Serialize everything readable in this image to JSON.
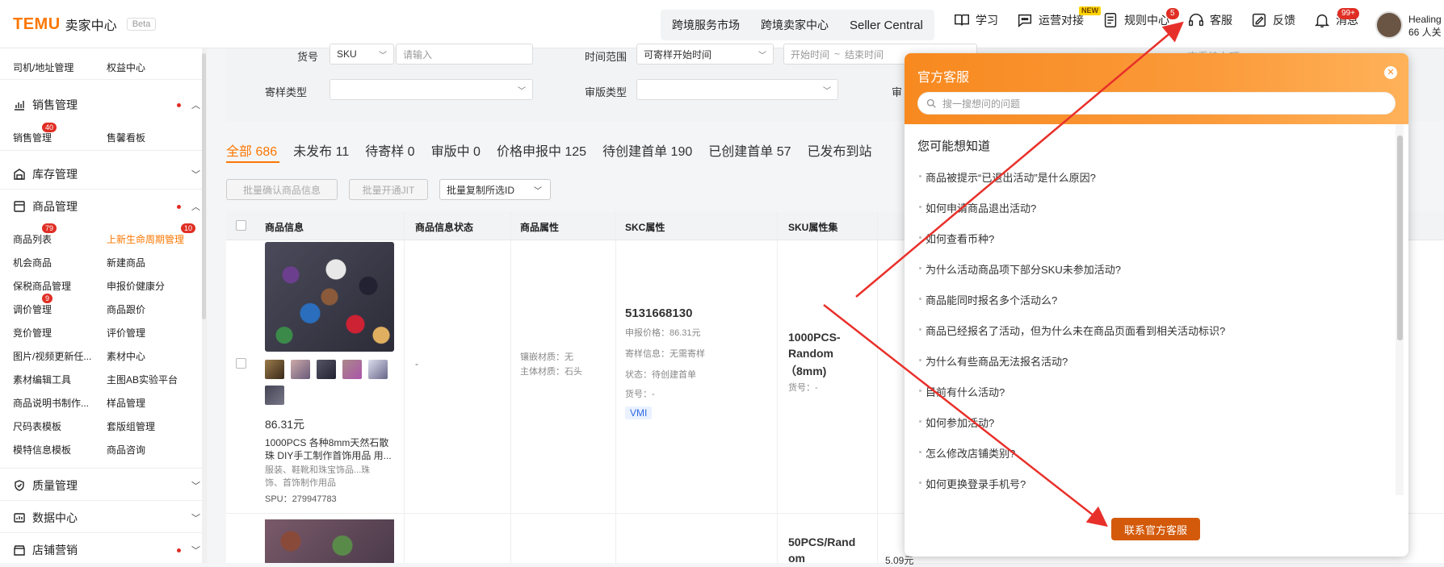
{
  "header": {
    "brand": "TEMU",
    "title": "卖家中心",
    "beta": "Beta",
    "nav": [
      "跨境服务市场",
      "跨境卖家中心",
      "Seller Central"
    ],
    "tools": [
      {
        "label": "学习",
        "icon": "book-icon",
        "badge": ""
      },
      {
        "label": "运营对接",
        "icon": "chat-icon",
        "badge": "NEW"
      },
      {
        "label": "规则中心",
        "icon": "rules-icon",
        "badge": "5"
      },
      {
        "label": "客服",
        "icon": "headset-icon",
        "badge": ""
      },
      {
        "label": "反馈",
        "icon": "feedback-icon",
        "badge": ""
      },
      {
        "label": "消息",
        "icon": "bell-icon",
        "badge": "99+"
      }
    ],
    "user_line1": "Healing",
    "user_line2": "66 人关"
  },
  "sidebar": {
    "top_items": [
      "司机/地址管理",
      "权益中心"
    ],
    "sections": [
      {
        "label": "销售管理",
        "icon": "chart-icon"
      },
      {
        "label": "库存管理",
        "icon": "warehouse-icon"
      },
      {
        "label": "商品管理",
        "icon": "goods-icon"
      },
      {
        "label": "质量管理",
        "icon": "shield-icon"
      },
      {
        "label": "数据中心",
        "icon": "data-icon"
      },
      {
        "label": "店铺营销",
        "icon": "shop-icon"
      }
    ],
    "sales_items": [
      {
        "label": "销售管理",
        "badge": "40"
      },
      {
        "label": "售馨看板",
        "badge": ""
      }
    ],
    "goods_items": [
      {
        "label": "商品列表",
        "badge": "79"
      },
      {
        "label": "上新生命周期管理",
        "badge": "10"
      },
      {
        "label": "机会商品",
        "badge": ""
      },
      {
        "label": "新建商品",
        "badge": ""
      },
      {
        "label": "保税商品管理",
        "badge": ""
      },
      {
        "label": "申报价健康分",
        "badge": ""
      },
      {
        "label": "调价管理",
        "badge": "9"
      },
      {
        "label": "商品跟价",
        "badge": ""
      },
      {
        "label": "竞价管理",
        "badge": ""
      },
      {
        "label": "评价管理",
        "badge": ""
      },
      {
        "label": "图片/视频更新任...",
        "badge": ""
      },
      {
        "label": "素材中心",
        "badge": ""
      },
      {
        "label": "素材编辑工具",
        "badge": ""
      },
      {
        "label": "主图AB实验平台",
        "badge": ""
      },
      {
        "label": "商品说明书制作...",
        "badge": ""
      },
      {
        "label": "样品管理",
        "badge": ""
      },
      {
        "label": "尺码表模板",
        "badge": ""
      },
      {
        "label": "套版组管理",
        "badge": ""
      },
      {
        "label": "模特信息模板",
        "badge": ""
      },
      {
        "label": "商品咨询",
        "badge": ""
      }
    ]
  },
  "filters": {
    "huohao_label": "货号",
    "huohao_select": "SKU",
    "huohao_placeholder": "请输入",
    "time_label": "时间范围",
    "time_select": "可寄样开始时间",
    "time_start": "开始时间",
    "time_sep": "~",
    "time_end": "结束时间",
    "jiyang_label": "寄样类型",
    "shenban_label": "审版类型",
    "cut_label": "审",
    "cut_label2": "查看待办项"
  },
  "tabs": [
    "全部 686",
    "未发布 11",
    "待寄样 0",
    "审版中 0",
    "价格申报中 125",
    "待创建首单 190",
    "已创建首单 57",
    "已发布到站"
  ],
  "buttons": [
    "批量确认商品信息",
    "批量开通JIT",
    "批量复制所选ID"
  ],
  "table": {
    "headers": [
      "商品信息",
      "商品信息状态",
      "商品属性",
      "SKC属性",
      "SKU属性集"
    ],
    "row1": {
      "price": "86.31元",
      "title_line1": "1000PCS 各种8mm天然石散",
      "title_line2": "珠 DIY手工制作首饰用品 用...",
      "cat_line1": "服装、鞋靴和珠宝饰品...珠",
      "cat_line2": "饰、首饰制作用品",
      "spu": "SPU：279947783",
      "status": "-",
      "attr1": "镶嵌材质：无",
      "attr2": "主体材质：石头",
      "skc_id": "5131668130",
      "skc_price": "申报价格：86.31元",
      "skc_sample": "寄样信息：无需寄样",
      "skc_state": "状态：待创建首单",
      "skc_huohao": "货号：-",
      "vmi": "VMI",
      "sku_line1": "1000PCS-",
      "sku_line2": "Random",
      "sku_line3": "（8mm)",
      "sku_huohao": "货号：-"
    },
    "row2": {
      "sku_line1": "50PCS/Rand",
      "sku_line2": "om",
      "price_peek": "5.09元"
    }
  },
  "panel": {
    "title": "官方客服",
    "search_placeholder": "搜一搜想问的问题",
    "subtitle": "您可能想知道",
    "faqs": [
      "商品被提示“已退出活动”是什么原因?",
      "如何申请商品退出活动?",
      "如何查看币种?",
      "为什么活动商品项下部分SKU未参加活动?",
      "商品能同时报名多个活动么?",
      "商品已经报名了活动，但为什么未在商品页面看到相关活动标识?",
      "为什么有些商品无法报名活动?",
      "目前有什么活动?",
      "如何参加活动?",
      "怎么修改店铺类别?",
      "如何更换登录手机号?"
    ],
    "contact_button": "联系官方客服"
  },
  "colors": {
    "accent": "#fb7701",
    "badge": "#e02e24",
    "panel_header": "#f7891f",
    "contact_button": "#d45a0b",
    "annotation_arrow": "#e8302a"
  }
}
